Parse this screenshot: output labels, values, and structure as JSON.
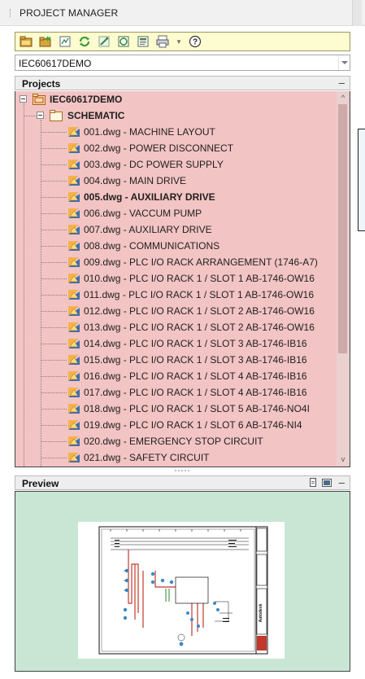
{
  "title": "PROJECT MANAGER",
  "toolbar": {
    "buttons": [
      {
        "icon": "open-project-icon"
      },
      {
        "icon": "new-project-icon"
      },
      {
        "icon": "new-drawing-icon"
      },
      {
        "icon": "refresh-icon"
      },
      {
        "icon": "project-properties-icon"
      },
      {
        "icon": "drawing-list-report-icon"
      },
      {
        "icon": "title-block-update-icon"
      },
      {
        "icon": "plot-publish-icon"
      },
      {
        "icon": "help-icon"
      }
    ]
  },
  "project_select": {
    "value": "IEC60617DEMO"
  },
  "projects_panel": {
    "title": "Projects",
    "collapse": "–",
    "project": "IEC60617DEMO",
    "folder": "SCHEMATIC",
    "drawings": [
      {
        "label": "001.dwg - MACHINE LAYOUT",
        "active": false
      },
      {
        "label": "002.dwg - POWER DISCONNECT",
        "active": false
      },
      {
        "label": "003.dwg - DC POWER SUPPLY",
        "active": false
      },
      {
        "label": "004.dwg - MAIN DRIVE",
        "active": false
      },
      {
        "label": "005.dwg - AUXILIARY DRIVE",
        "active": true
      },
      {
        "label": "006.dwg - VACCUM PUMP",
        "active": false
      },
      {
        "label": "007.dwg - AUXILIARY DRIVE",
        "active": false
      },
      {
        "label": "008.dwg - COMMUNICATIONS",
        "active": false
      },
      {
        "label": "009.dwg - PLC I/O RACK ARRANGEMENT (1746-A7)",
        "active": false
      },
      {
        "label": "010.dwg - PLC I/O RACK 1 / SLOT 1  AB-1746-OW16",
        "active": false
      },
      {
        "label": "011.dwg - PLC I/O RACK 1 / SLOT 1  AB-1746-OW16",
        "active": false
      },
      {
        "label": "012.dwg - PLC I/O RACK 1 / SLOT 2  AB-1746-OW16",
        "active": false
      },
      {
        "label": "013.dwg - PLC I/O RACK 1 / SLOT 2  AB-1746-OW16",
        "active": false
      },
      {
        "label": "014.dwg - PLC I/O RACK 1 / SLOT 3  AB-1746-IB16",
        "active": false
      },
      {
        "label": "015.dwg - PLC I/O RACK 1 / SLOT 3  AB-1746-IB16",
        "active": false
      },
      {
        "label": "016.dwg - PLC I/O RACK 1 / SLOT 4  AB-1746-IB16",
        "active": false
      },
      {
        "label": "017.dwg - PLC I/O RACK 1 / SLOT 4  AB-1746-IB16",
        "active": false
      },
      {
        "label": "018.dwg - PLC I/O RACK 1 / SLOT 5  AB-1746-NO4I",
        "active": false
      },
      {
        "label": "019.dwg - PLC I/O RACK 1 / SLOT 6  AB-1746-NI4",
        "active": false
      },
      {
        "label": "020.dwg - EMERGENCY STOP CIRCUIT",
        "active": false
      },
      {
        "label": "021.dwg - SAFETY CIRCUIT",
        "active": false
      }
    ],
    "colors": {
      "background": "#f3c4c4",
      "border": "#444444"
    }
  },
  "preview_panel": {
    "title": "Preview",
    "collapse": "–",
    "icons": [
      "page-preview-icon",
      "thumbnail-view-icon"
    ],
    "colors": {
      "background": "#c9e6d5"
    }
  }
}
